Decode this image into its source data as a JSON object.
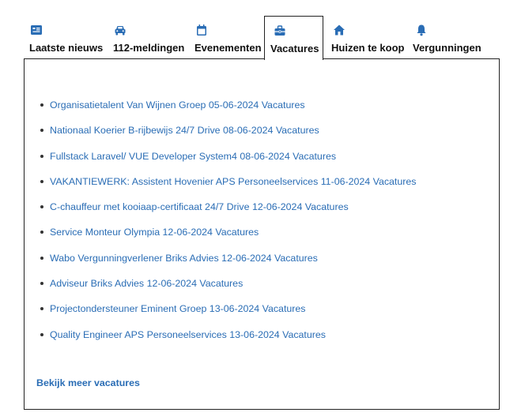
{
  "tabs": [
    {
      "label": "Laatste nieuws",
      "icon": "news-icon",
      "active": false
    },
    {
      "label": "112-meldingen",
      "icon": "car-icon",
      "active": false
    },
    {
      "label": "Evenementen",
      "icon": "calendar-icon",
      "active": false
    },
    {
      "label": "Vacatures",
      "icon": "briefcase-icon",
      "active": true
    },
    {
      "label": "Huizen te koop",
      "icon": "house-icon",
      "active": false
    },
    {
      "label": "Vergunningen",
      "icon": "bell-icon",
      "active": false
    }
  ],
  "colors": {
    "accent": "#2a6db5",
    "text": "#111111",
    "border": "#222222"
  },
  "vacatures": [
    {
      "text": "Organisatietalent Van Wijnen Groep 05-06-2024 Vacatures"
    },
    {
      "text": "Nationaal Koerier B-rijbewijs 24/7 Drive 08-06-2024 Vacatures"
    },
    {
      "text": "Fullstack Laravel/ VUE Developer System4 08-06-2024 Vacatures"
    },
    {
      "text": "VAKANTIEWERK: Assistent Hovenier APS Personeelservices 11-06-2024 Vacatures"
    },
    {
      "text": "C-chauffeur met kooiaap-certificaat 24/7 Drive 12-06-2024 Vacatures"
    },
    {
      "text": "Service Monteur Olympia 12-06-2024 Vacatures"
    },
    {
      "text": "Wabo Vergunningverlener Briks Advies 12-06-2024 Vacatures"
    },
    {
      "text": "Adviseur Briks Advies 12-06-2024 Vacatures"
    },
    {
      "text": "Projectondersteuner Eminent Groep 13-06-2024 Vacatures"
    },
    {
      "text": "Quality Engineer APS Personeelservices 13-06-2024 Vacatures"
    }
  ],
  "more_link": "Bekijk meer vacatures"
}
